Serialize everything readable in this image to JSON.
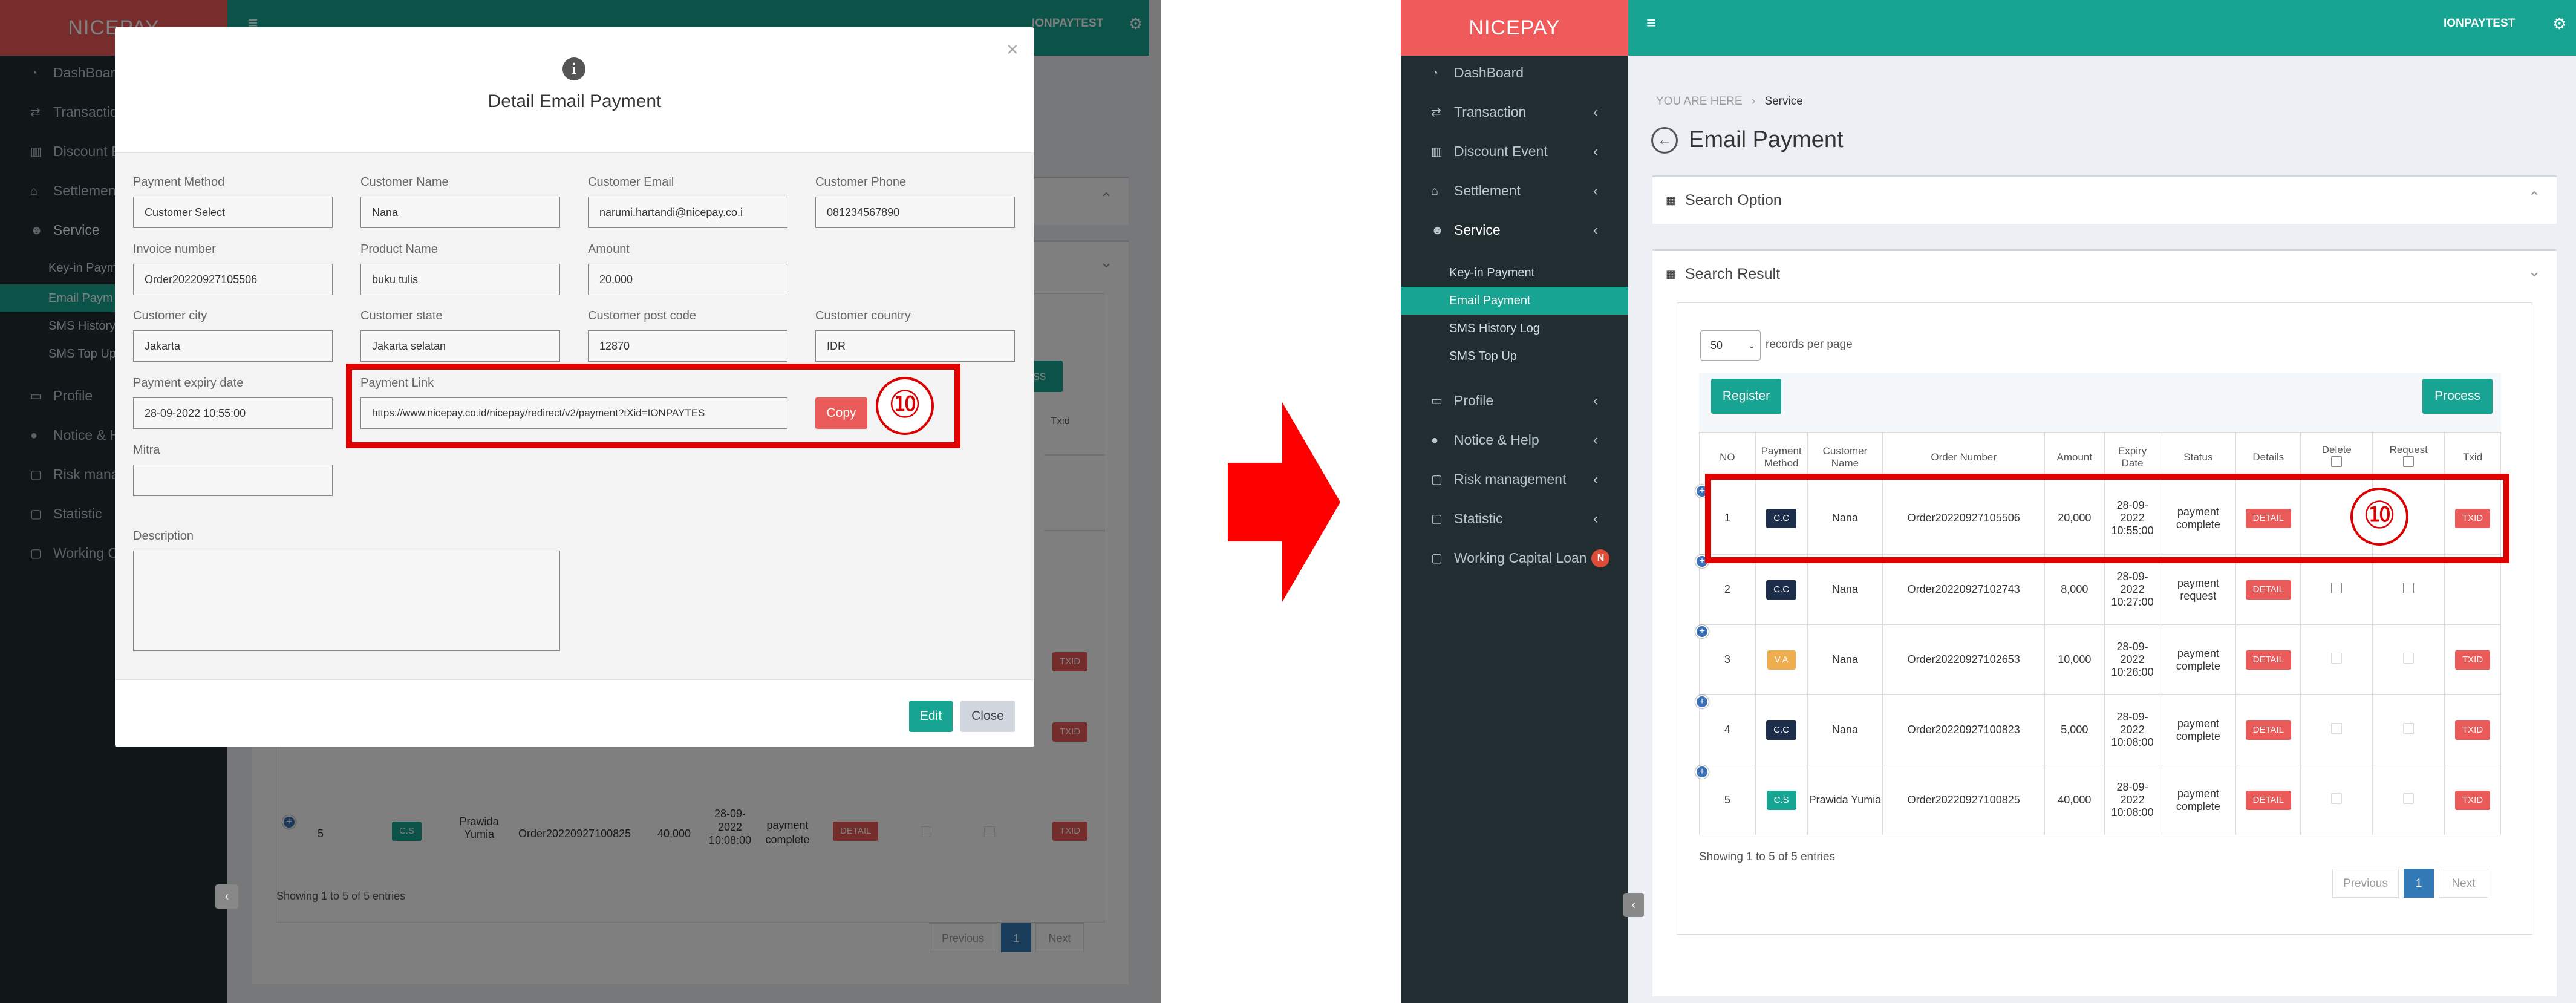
{
  "app": {
    "logo": "NICEPAY",
    "user": "IONPAYTEST"
  },
  "sidebar": {
    "items": [
      {
        "label": "DashBoard",
        "icon": "dashboard-icon"
      },
      {
        "label": "Transaction",
        "icon": "exchange-icon"
      },
      {
        "label": "Discount Event",
        "icon": "bar-chart-icon"
      },
      {
        "label": "Settlement",
        "icon": "bank-icon"
      },
      {
        "label": "Service",
        "icon": "users-icon"
      },
      {
        "label": "Profile",
        "icon": "monitor-icon"
      },
      {
        "label": "Notice & Help",
        "icon": "comment-icon"
      },
      {
        "label": "Risk management",
        "icon": "folder-icon"
      },
      {
        "label": "Statistic",
        "icon": "folder-icon"
      },
      {
        "label": "Working Capital Loan",
        "icon": "folder-icon",
        "badge": "N"
      }
    ],
    "sub_items": [
      "Key-in Payment",
      "Email Payment",
      "SMS History Log",
      "SMS Top Up"
    ]
  },
  "left_sidebar_truncated": {
    "items": [
      "DashBoard",
      "Transaction",
      "Discount E",
      "Settlement",
      "Service",
      "Profile",
      "Notice & He",
      "Risk manag",
      "Statistic",
      "Working Ca"
    ],
    "sub_items": [
      "Key-in Payme",
      "Email Paym",
      "SMS History",
      "SMS Top Up"
    ]
  },
  "breadcrumb": {
    "prefix": "YOU ARE HERE",
    "sep": "›",
    "current": "Service"
  },
  "page": {
    "title": "Email Payment"
  },
  "search_option": {
    "title": "Search Option"
  },
  "search_result": {
    "title": "Search Result"
  },
  "controls": {
    "per_page": "50",
    "per_page_suffix": "records per page",
    "register": "Register",
    "process": "Process",
    "process_partial": "ocess"
  },
  "table": {
    "headers": [
      "NO",
      "Payment Method",
      "Customer Name",
      "Order Number",
      "Amount",
      "Expiry Date",
      "Status",
      "Details",
      "Delete",
      "Request",
      "Txid"
    ],
    "rows": [
      {
        "no": "1",
        "method": "C.C",
        "name": "Nana",
        "order": "Order20220927105506",
        "amount": "20,000",
        "expiry": "28-09-2022 10:55:00",
        "status": "payment complete",
        "details": "DETAIL",
        "txid": "TXID"
      },
      {
        "no": "2",
        "method": "C.C",
        "name": "Nana",
        "order": "Order20220927102743",
        "amount": "8,000",
        "expiry": "28-09-2022 10:27:00",
        "status": "payment request",
        "details": "DETAIL",
        "txid": ""
      },
      {
        "no": "3",
        "method": "V.A",
        "name": "Nana",
        "order": "Order20220927102653",
        "amount": "10,000",
        "expiry": "28-09-2022 10:26:00",
        "status": "payment complete",
        "details": "DETAIL",
        "txid": "TXID"
      },
      {
        "no": "4",
        "method": "C.C",
        "name": "Nana",
        "order": "Order20220927100823",
        "amount": "5,000",
        "expiry": "28-09-2022 10:08:00",
        "status": "payment complete",
        "details": "DETAIL",
        "txid": "TXID"
      },
      {
        "no": "5",
        "method": "C.S",
        "name": "Prawida Yumia",
        "order": "Order20220927100825",
        "amount": "40,000",
        "expiry": "28-09-2022 10:08:00",
        "status": "payment complete",
        "details": "DETAIL",
        "txid": "TXID"
      }
    ]
  },
  "footer": {
    "entries": "Showing 1 to 5 of 5 entries",
    "previous": "Previous",
    "page": "1",
    "next": "Next"
  },
  "modal": {
    "title": "Detail Email Payment",
    "fields": {
      "payment_method": {
        "label": "Payment Method",
        "value": "Customer Select"
      },
      "customer_name": {
        "label": "Customer Name",
        "value": "Nana"
      },
      "customer_email": {
        "label": "Customer Email",
        "value": "narumi.hartandi@nicepay.co.i"
      },
      "customer_phone": {
        "label": "Customer Phone",
        "value": "081234567890"
      },
      "invoice_number": {
        "label": "Invoice number",
        "value": "Order20220927105506"
      },
      "product_name": {
        "label": "Product Name",
        "value": "buku tulis"
      },
      "amount": {
        "label": "Amount",
        "value": "20,000"
      },
      "customer_city": {
        "label": "Customer city",
        "value": "Jakarta"
      },
      "customer_state": {
        "label": "Customer state",
        "value": "Jakarta selatan"
      },
      "customer_post_code": {
        "label": "Customer post code",
        "value": "12870"
      },
      "customer_country": {
        "label": "Customer country",
        "value": "IDR"
      },
      "payment_expiry": {
        "label": "Payment expiry date",
        "value": "28-09-2022 10:55:00"
      },
      "payment_link": {
        "label": "Payment Link",
        "value": "https://www.nicepay.co.id/nicepay/redirect/v2/payment?tXid=IONPAYTES"
      },
      "mitra": {
        "label": "Mitra",
        "value": ""
      },
      "description": {
        "label": "Description",
        "value": ""
      }
    },
    "copy": "Copy",
    "edit": "Edit",
    "close": "Close"
  },
  "annotation": {
    "step": "⑩",
    "highlight_color": "#e00000"
  },
  "colors": {
    "brand": "#f05a5a",
    "accent": "#17a493",
    "danger": "#ea5a58",
    "sidebar": "#222d32"
  }
}
